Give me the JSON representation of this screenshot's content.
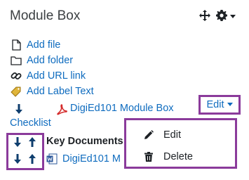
{
  "block": {
    "title": "Module Box"
  },
  "header_controls": {
    "move_icon": "move-icon",
    "settings_icon": "gear-icon"
  },
  "add_links": [
    {
      "label": "Add file",
      "icon": "file-icon"
    },
    {
      "label": "Add folder",
      "icon": "folder-icon"
    },
    {
      "label": "Add URL link",
      "icon": "link-icon"
    },
    {
      "label": "Add Label Text",
      "icon": "tag-icon"
    }
  ],
  "file_item": {
    "name": "DigiEd101 Module Box",
    "icon": "pdf-icon",
    "edit_label": "Edit"
  },
  "checklist": {
    "label": "Checklist"
  },
  "section": {
    "title": "Key Documents",
    "doc_name": "DigiEd101 M",
    "doc_icon": "word-doc-icon"
  },
  "edit_menu": {
    "items": [
      {
        "label": "Edit",
        "icon": "pencil-icon"
      },
      {
        "label": "Delete",
        "icon": "trash-icon"
      }
    ]
  },
  "colors": {
    "link": "#0f6cbf",
    "highlight_border": "#8b3b9b",
    "arrow": "#0f3e6e"
  }
}
